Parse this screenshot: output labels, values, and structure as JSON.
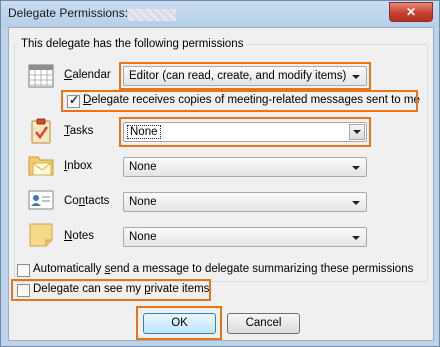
{
  "window": {
    "title": "Delegate Permissions:",
    "close_glyph": "✕"
  },
  "group_label": "This delegate has the following permissions",
  "rows": [
    {
      "label_pre": "",
      "label_key": "C",
      "label_post": "alendar",
      "value": "Editor (can read, create, and modify items)",
      "icon": "calendar-icon"
    },
    {
      "label_pre": "",
      "label_key": "T",
      "label_post": "asks",
      "value": "None",
      "icon": "tasks-clipboard-icon"
    },
    {
      "label_pre": "",
      "label_key": "I",
      "label_post": "nbox",
      "value": "None",
      "icon": "inbox-folder-icon"
    },
    {
      "label_pre": "Co",
      "label_key": "n",
      "label_post": "tacts",
      "value": "None",
      "icon": "contacts-card-icon"
    },
    {
      "label_pre": "",
      "label_key": "N",
      "label_post": "otes",
      "value": "None",
      "icon": "notes-icon"
    }
  ],
  "meeting_copies": {
    "pre": "",
    "key": "D",
    "post": "elegate receives copies of meeting-related messages sent to me",
    "checked": true
  },
  "auto_send": {
    "pre": "Automatically ",
    "key": "s",
    "post": "end a message to delegate summarizing these permissions",
    "checked": false
  },
  "private_items": {
    "pre": "Delegate can see my ",
    "key": "p",
    "post": "rivate items",
    "checked": false
  },
  "buttons": {
    "ok": "OK",
    "cancel": "Cancel"
  },
  "colors": {
    "highlight": "#e8751a",
    "titlebar": "#bcd3ea",
    "close": "#c6402f"
  }
}
